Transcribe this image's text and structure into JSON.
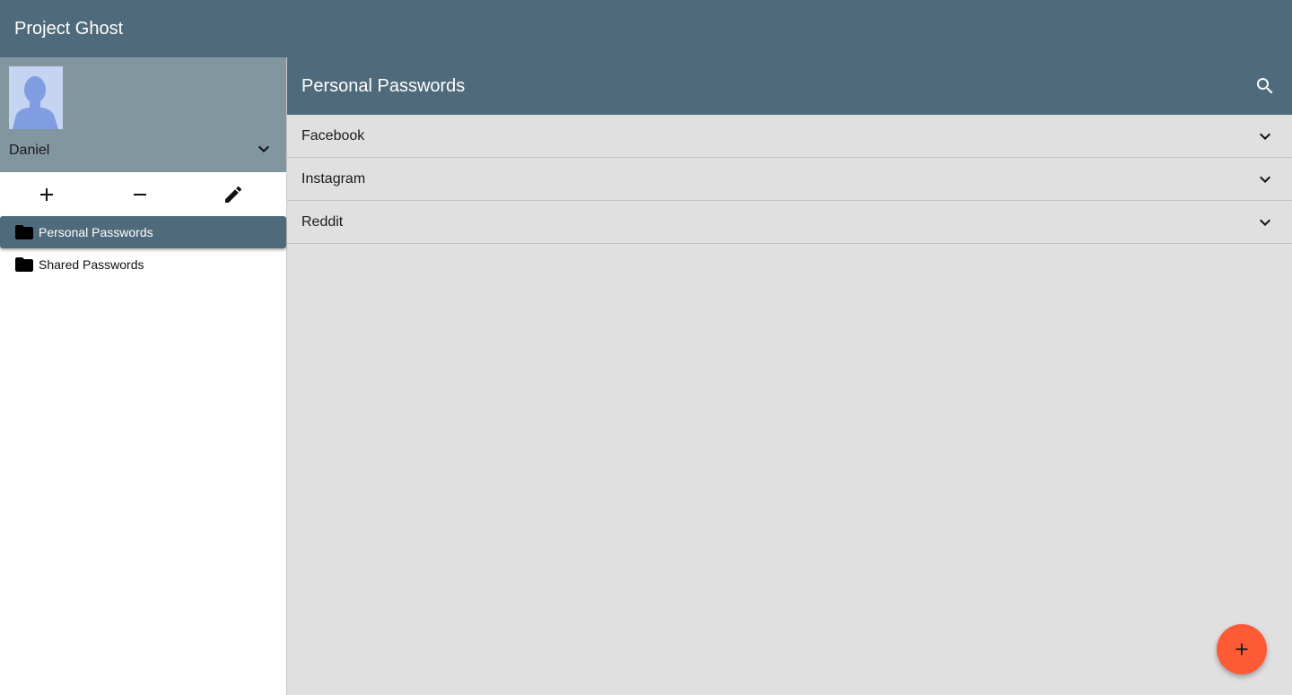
{
  "app": {
    "title": "Project Ghost"
  },
  "user": {
    "name": "Daniel",
    "avatar_icon": "person-silhouette-icon"
  },
  "sidebar": {
    "actions": [
      {
        "icon": "plus-icon"
      },
      {
        "icon": "minus-icon"
      },
      {
        "icon": "pencil-icon"
      }
    ],
    "folders": [
      {
        "label": "Personal Passwords",
        "icon": "folder-icon",
        "active": true
      },
      {
        "label": "Shared Passwords",
        "icon": "folder-icon",
        "active": false
      }
    ]
  },
  "main": {
    "title": "Personal Passwords",
    "search_icon": "search-icon",
    "entries": [
      {
        "label": "Facebook"
      },
      {
        "label": "Instagram"
      },
      {
        "label": "Reddit"
      }
    ]
  },
  "fab": {
    "icon": "plus-icon"
  },
  "colors": {
    "primary": "#4f6a7a",
    "profile_bg": "#8296a0",
    "content_bg": "#e0e0e0",
    "accent": "#ff5a36"
  }
}
